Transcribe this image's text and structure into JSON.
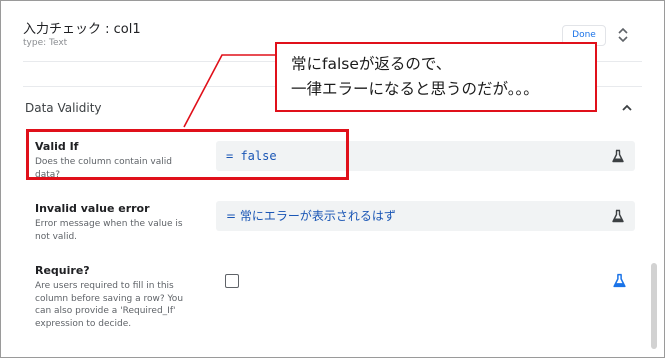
{
  "header": {
    "title": "入力チェック : col1",
    "type_label": "type: Text",
    "done_label": "Done"
  },
  "section": {
    "title": "Data Validity"
  },
  "fields": {
    "valid_if": {
      "label": "Valid If",
      "description_line1": "Does the column contain valid",
      "description_line2": "data?",
      "expression": "= false"
    },
    "invalid_value_error": {
      "label": "Invalid value error",
      "description_line1": "Error message when the value is",
      "description_line2": "not valid.",
      "expression": "= 常にエラーが表示されるはず"
    },
    "require": {
      "label": "Require?",
      "description_line1": "Are users required to fill in this",
      "description_line2": "column before saving a row? You",
      "description_line3": "can also provide a 'Required_If'",
      "description_line4": "expression to decide.",
      "checked": false
    }
  },
  "callout": {
    "line1": "常にfalseが返るので、",
    "line2": "一律エラーになると思うのだが。。。"
  },
  "colors": {
    "annotation_red": "#e0101a",
    "expression_blue": "#1a56b5",
    "link_blue": "#1a73e8"
  },
  "icons": [
    "updown-icon",
    "chevron-up-icon",
    "flask-icon"
  ]
}
